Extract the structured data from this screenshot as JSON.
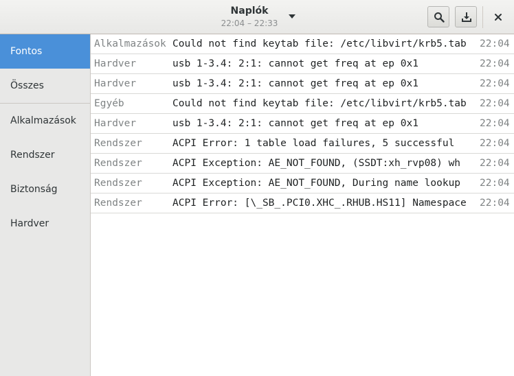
{
  "header": {
    "title": "Naplók",
    "subtitle": "22:04 – 22:33",
    "icons": {
      "menu": "chevron-down-icon",
      "search": "search-icon",
      "export": "download-icon",
      "close": "close-icon"
    }
  },
  "sidebar": {
    "items": [
      {
        "label": "Fontos",
        "selected": true
      },
      {
        "label": "Összes",
        "selected": false
      },
      {
        "label": "Alkalmazások",
        "selected": false
      },
      {
        "label": "Rendszer",
        "selected": false
      },
      {
        "label": "Biztonság",
        "selected": false
      },
      {
        "label": "Hardver",
        "selected": false
      }
    ]
  },
  "logs": [
    {
      "category": "Alkalmazások",
      "message": "Could not find keytab file: /etc/libvirt/krb5.tab",
      "time": "22:04"
    },
    {
      "category": "Hardver",
      "message": "usb 1-3.4: 2:1: cannot get freq at ep 0x1",
      "time": "22:04"
    },
    {
      "category": "Hardver",
      "message": "usb 1-3.4: 2:1: cannot get freq at ep 0x1",
      "time": "22:04"
    },
    {
      "category": "Egyéb",
      "message": "Could not find keytab file: /etc/libvirt/krb5.tab",
      "time": "22:04"
    },
    {
      "category": "Hardver",
      "message": "usb 1-3.4: 2:1: cannot get freq at ep 0x1",
      "time": "22:04"
    },
    {
      "category": "Rendszer",
      "message": "ACPI Error: 1 table load failures, 5 successful",
      "time": "22:04"
    },
    {
      "category": "Rendszer",
      "message": "ACPI Exception: AE_NOT_FOUND, (SSDT:xh_rvp08) wh",
      "time": "22:04"
    },
    {
      "category": "Rendszer",
      "message": "ACPI Exception: AE_NOT_FOUND, During name lookup",
      "time": "22:04"
    },
    {
      "category": "Rendszer",
      "message": "ACPI Error: [\\_SB_.PCI0.XHC_.RHUB.HS11] Namespace",
      "time": "22:04"
    }
  ],
  "colors": {
    "accent": "#4a90d9",
    "sidebar_bg": "#e8e8e7",
    "category_text": "#7f8384"
  }
}
